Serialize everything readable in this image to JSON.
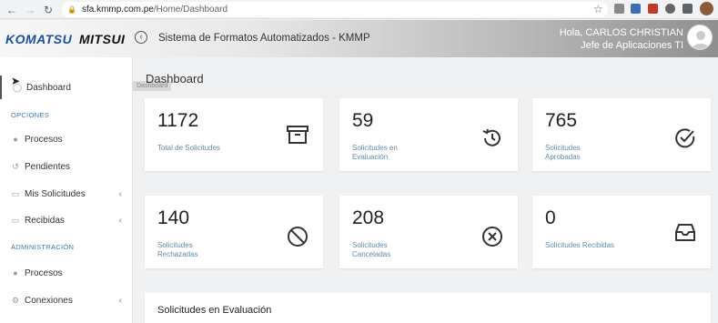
{
  "browser": {
    "url_host": "sfa.kmmp.com.pe",
    "url_path": "/Home/Dashboard"
  },
  "header": {
    "brand_komatsu": "KOMATSU",
    "brand_mitsui": "MITSUI",
    "app_title": "Sistema de Formatos Automatizados - KMMP",
    "greeting": "Hola, CARLOS CHRISTIAN",
    "role": "Jefe de Aplicaciones TI"
  },
  "sidebar": {
    "dashboard_label": "Dashboard",
    "section_opciones": "OPCIONES",
    "opciones": [
      {
        "label": "Procesos",
        "icon": "circle-icon",
        "expandable": false
      },
      {
        "label": "Pendientes",
        "icon": "history-icon",
        "expandable": false
      },
      {
        "label": "Mis Solicitudes",
        "icon": "document-icon",
        "expandable": true
      },
      {
        "label": "Recibidas",
        "icon": "document-icon",
        "expandable": true
      }
    ],
    "section_administracion": "ADMINISTRACIÓN",
    "administracion": [
      {
        "label": "Procesos",
        "icon": "circle-icon",
        "expandable": false
      },
      {
        "label": "Conexiones",
        "icon": "gear-icon",
        "expandable": true
      }
    ],
    "tooltip": "Dashboard"
  },
  "main": {
    "page_title": "Dashboard",
    "cards": [
      {
        "value": "1172",
        "label": "Total de Solicitudes",
        "icon": "archive-icon"
      },
      {
        "value": "59",
        "label": "Solicitudes en Evaluación",
        "icon": "history-icon"
      },
      {
        "value": "765",
        "label": "Solicitudes Aprobadas",
        "icon": "check-circle-icon"
      },
      {
        "value": "140",
        "label": "Solicitudes Rechazadas",
        "icon": "ban-icon"
      },
      {
        "value": "208",
        "label": "Solicitudes Canceladas",
        "icon": "x-circle-icon"
      },
      {
        "value": "0",
        "label": "Solicitudes Recibidas",
        "icon": "inbox-icon"
      }
    ],
    "section_title": "Solicitudes en Evaluación"
  },
  "colors": {
    "brand_blue": "#1c4fa1",
    "label_blue": "#5f8ca8",
    "section_blue": "#3b7ab8"
  }
}
